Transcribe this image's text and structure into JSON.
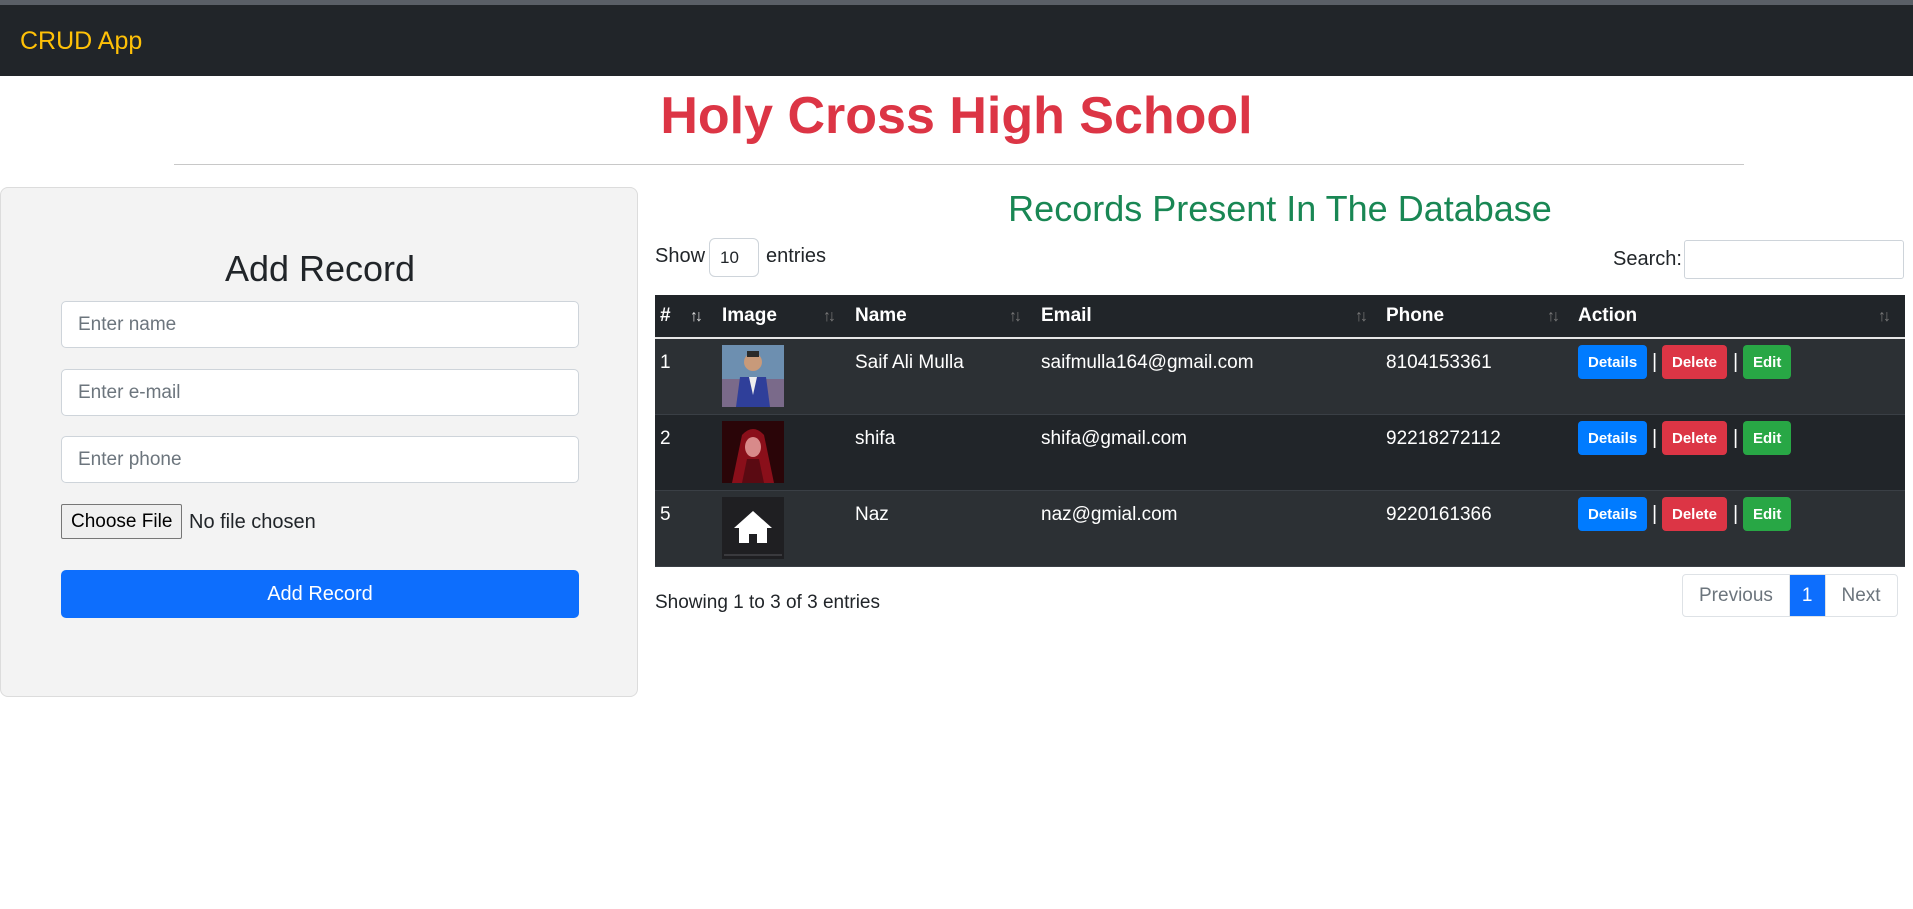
{
  "navbar": {
    "brand": "CRUD App"
  },
  "school_title": "Holy Cross High School",
  "form": {
    "title": "Add Record",
    "name_placeholder": "Enter name",
    "email_placeholder": "Enter e-mail",
    "phone_placeholder": "Enter phone",
    "file_button": "Choose File",
    "file_status": "No file chosen",
    "submit_label": "Add Record"
  },
  "records": {
    "title": "Records Present In The Database",
    "show_label": "Show",
    "length_value": "10",
    "entries_label": "entries",
    "search_label": "Search:",
    "search_value": "",
    "columns": [
      "#",
      "Image",
      "Name",
      "Email",
      "Phone",
      "Action"
    ],
    "rows": [
      {
        "id": "1",
        "name": "Saif Ali Mulla",
        "email": "saifmulla164@gmail.com",
        "phone": "8104153361"
      },
      {
        "id": "2",
        "name": "shifa",
        "email": "shifa@gmail.com",
        "phone": "92218272112"
      },
      {
        "id": "5",
        "name": "Naz",
        "email": "naz@gmial.com",
        "phone": "9220161366"
      }
    ],
    "actions": {
      "details": "Details",
      "delete": "Delete",
      "edit": "Edit",
      "separator": "|"
    },
    "info": "Showing 1 to 3 of 3 entries",
    "pagination": {
      "previous": "Previous",
      "current": "1",
      "next": "Next"
    }
  },
  "colors": {
    "brand": "#ffc107",
    "title": "#dc3545",
    "records_title": "#198754",
    "primary": "#0d6efd",
    "details": "#007bff",
    "delete": "#dc3545",
    "edit": "#28a745",
    "table_bg": "#212529"
  },
  "icons": {
    "sort": "sort-arrows-icon",
    "row5_image": "home-icon"
  }
}
